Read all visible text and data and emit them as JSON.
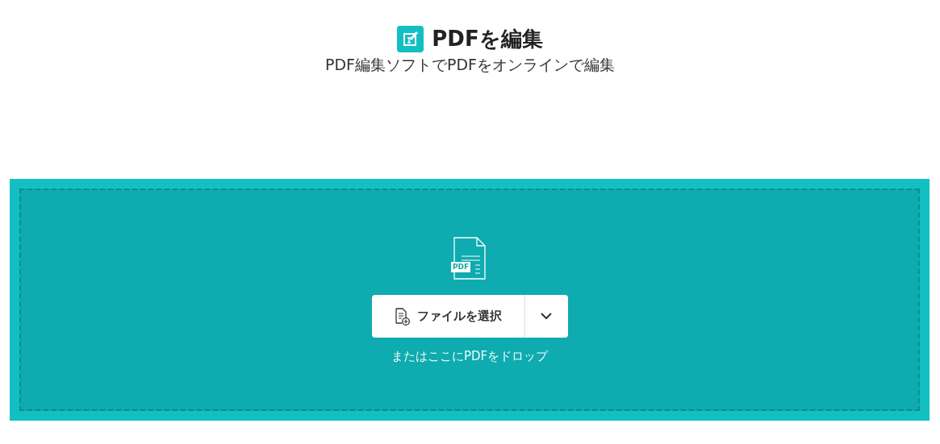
{
  "header": {
    "title": "PDFを編集",
    "subtitle": "PDF編集ソフトでPDFをオンラインで編集"
  },
  "dropzone": {
    "file_badge": "PDF",
    "choose_button": "ファイルを選択",
    "hint": "またはここにPDFをドロップ"
  }
}
